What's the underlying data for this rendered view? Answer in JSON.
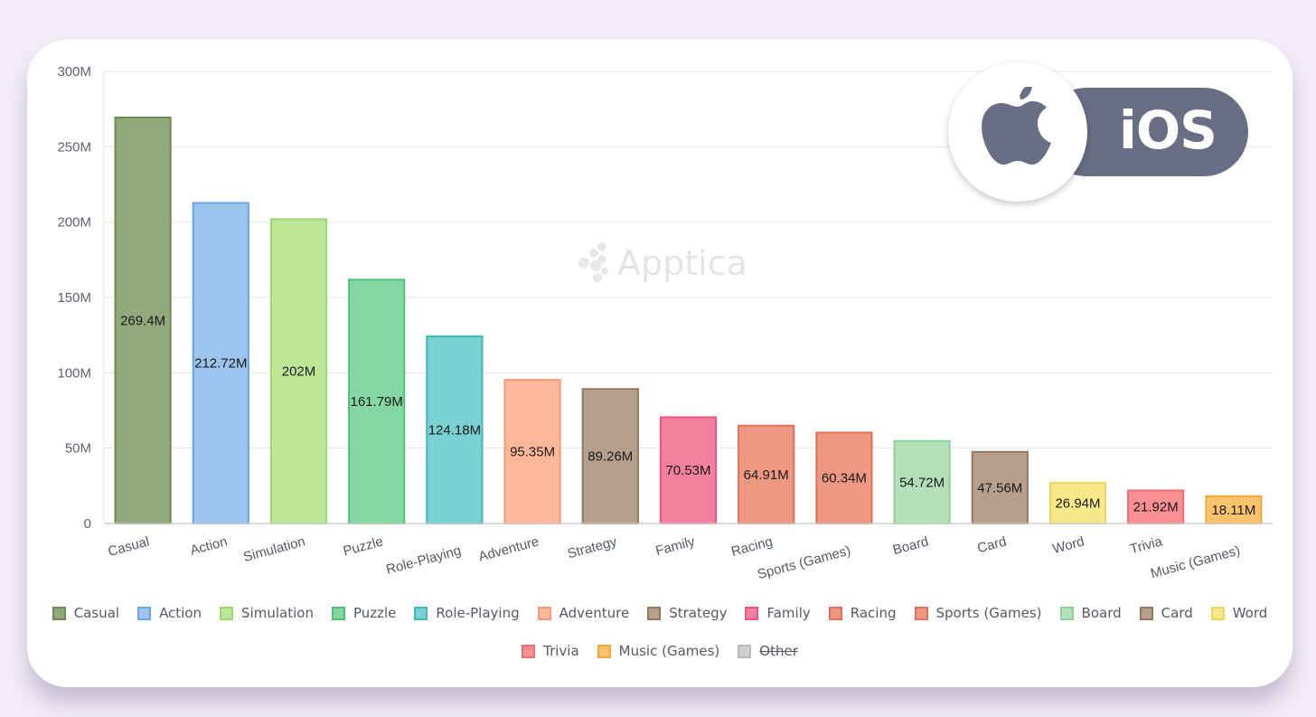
{
  "badge": {
    "platform_label": "iOS",
    "icon": "apple-icon"
  },
  "watermark": {
    "text": "Apptica",
    "icon": "apptica-logo-icon"
  },
  "chart_data": {
    "type": "bar",
    "title": "",
    "xlabel": "",
    "ylabel": "",
    "ylim": [
      0,
      300000000
    ],
    "yticks": [
      0,
      50000000,
      100000000,
      150000000,
      200000000,
      250000000,
      300000000
    ],
    "ytick_labels": [
      "0",
      "50M",
      "100M",
      "150M",
      "200M",
      "250M",
      "300M"
    ],
    "grid": true,
    "legend_position": "bottom",
    "categories": [
      "Casual",
      "Action",
      "Simulation",
      "Puzzle",
      "Role-Playing",
      "Adventure",
      "Strategy",
      "Family",
      "Racing",
      "Sports (Games)",
      "Board",
      "Card",
      "Word",
      "Trivia",
      "Music (Games)"
    ],
    "values": [
      269400000,
      212720000,
      202000000,
      161790000,
      124180000,
      95350000,
      89260000,
      70530000,
      64910000,
      60340000,
      54720000,
      47560000,
      26940000,
      21920000,
      18110000
    ],
    "data_labels": [
      "269.4M",
      "212.72M",
      "202M",
      "161.79M",
      "124.18M",
      "95.35M",
      "89.26M",
      "70.53M",
      "64.91M",
      "60.34M",
      "54.72M",
      "47.56M",
      "26.94M",
      "21.92M",
      "18.11M"
    ],
    "colors": [
      "#93a97c",
      "#9cc4ee",
      "#bde796",
      "#84d7a2",
      "#7ad1d1",
      "#fdb89a",
      "#b79f8d",
      "#f3809f",
      "#ef9881",
      "#ef9881",
      "#b3e0b8",
      "#b79f8d",
      "#f7e88a",
      "#f78f93",
      "#fbc46c"
    ],
    "border_colors": [
      "#6f8a57",
      "#6aa6e2",
      "#9cd96e",
      "#4fc07a",
      "#3fb7b9",
      "#f79a77",
      "#93775f",
      "#e85784",
      "#e0705a",
      "#e0705a",
      "#8bd198",
      "#93775f",
      "#ecd560",
      "#ef6a72",
      "#f2a93a"
    ],
    "legend": [
      {
        "label": "Casual",
        "color": "#93a97c",
        "border": "#6f8a57",
        "hidden": false
      },
      {
        "label": "Action",
        "color": "#9cc4ee",
        "border": "#6aa6e2",
        "hidden": false
      },
      {
        "label": "Simulation",
        "color": "#bde796",
        "border": "#9cd96e",
        "hidden": false
      },
      {
        "label": "Puzzle",
        "color": "#84d7a2",
        "border": "#4fc07a",
        "hidden": false
      },
      {
        "label": "Role-Playing",
        "color": "#7ad1d1",
        "border": "#3fb7b9",
        "hidden": false
      },
      {
        "label": "Adventure",
        "color": "#fdb89a",
        "border": "#f79a77",
        "hidden": false
      },
      {
        "label": "Strategy",
        "color": "#b79f8d",
        "border": "#93775f",
        "hidden": false
      },
      {
        "label": "Family",
        "color": "#f3809f",
        "border": "#e85784",
        "hidden": false
      },
      {
        "label": "Racing",
        "color": "#ef9881",
        "border": "#e0705a",
        "hidden": false
      },
      {
        "label": "Sports (Games)",
        "color": "#ef9881",
        "border": "#e0705a",
        "hidden": false
      },
      {
        "label": "Board",
        "color": "#b3e0b8",
        "border": "#8bd198",
        "hidden": false
      },
      {
        "label": "Card",
        "color": "#b79f8d",
        "border": "#93775f",
        "hidden": false
      },
      {
        "label": "Word",
        "color": "#f7e88a",
        "border": "#ecd560",
        "hidden": false
      },
      {
        "label": "Trivia",
        "color": "#f78f93",
        "border": "#ef6a72",
        "hidden": false
      },
      {
        "label": "Music (Games)",
        "color": "#fbc46c",
        "border": "#f2a93a",
        "hidden": false
      },
      {
        "label": "Other",
        "color": "#d0d0d0",
        "border": "#b8b8b8",
        "hidden": true
      }
    ]
  }
}
